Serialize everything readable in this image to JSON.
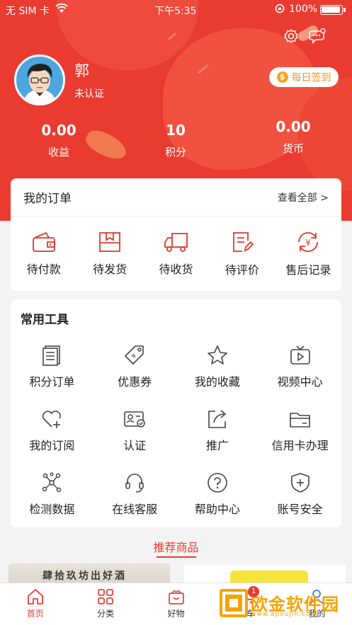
{
  "status_bar": {
    "carrier": "无 SIM 卡",
    "time": "下午5:35",
    "battery": "100%"
  },
  "profile": {
    "name": "郭",
    "verify_status": "未认证",
    "signin_label": "每日签到",
    "signin_icon_text": "$"
  },
  "stats": [
    {
      "value": "0.00",
      "label": "收益"
    },
    {
      "value": "10",
      "label": "积分"
    },
    {
      "value": "0.00",
      "label": "货币"
    }
  ],
  "orders": {
    "title": "我的订单",
    "view_all": "查看全部 >",
    "items": [
      {
        "label": "待付款",
        "icon": "wallet-icon"
      },
      {
        "label": "待发货",
        "icon": "box-icon"
      },
      {
        "label": "待收货",
        "icon": "truck-icon"
      },
      {
        "label": "待评价",
        "icon": "review-icon"
      },
      {
        "label": "售后记录",
        "icon": "refund-icon"
      }
    ]
  },
  "tools": {
    "title": "常用工具",
    "items": [
      {
        "label": "积分订单",
        "icon": "document-icon"
      },
      {
        "label": "优惠券",
        "icon": "coupon-tag-icon"
      },
      {
        "label": "我的收藏",
        "icon": "star-icon"
      },
      {
        "label": "视频中心",
        "icon": "tv-icon"
      },
      {
        "label": "我的订阅",
        "icon": "heart-plus-icon"
      },
      {
        "label": "认证",
        "icon": "id-card-icon"
      },
      {
        "label": "推广",
        "icon": "share-icon"
      },
      {
        "label": "信用卡办理",
        "icon": "card-icon"
      },
      {
        "label": "检测数据",
        "icon": "network-icon"
      },
      {
        "label": "在线客服",
        "icon": "headset-icon"
      },
      {
        "label": "帮助中心",
        "icon": "help-icon"
      },
      {
        "label": "账号安全",
        "icon": "shield-icon"
      }
    ]
  },
  "recommend": {
    "title": "推荐商品",
    "product1_text": "肆拾玖坊出好酒"
  },
  "tabbar": [
    {
      "label": "首页",
      "icon": "home-icon"
    },
    {
      "label": "分类",
      "icon": "grid-icon"
    },
    {
      "label": "好物",
      "icon": "gift-icon"
    },
    {
      "label": "物车",
      "icon": "cart-icon",
      "badge": "1"
    },
    {
      "label": "我的",
      "icon": "user-icon"
    }
  ],
  "watermark": {
    "text": "欧金软件园",
    "url": "www.apoujin.com"
  },
  "colors": {
    "brand": "#ea3b30",
    "accent": "#f0932b",
    "background": "#f3f3f3"
  }
}
